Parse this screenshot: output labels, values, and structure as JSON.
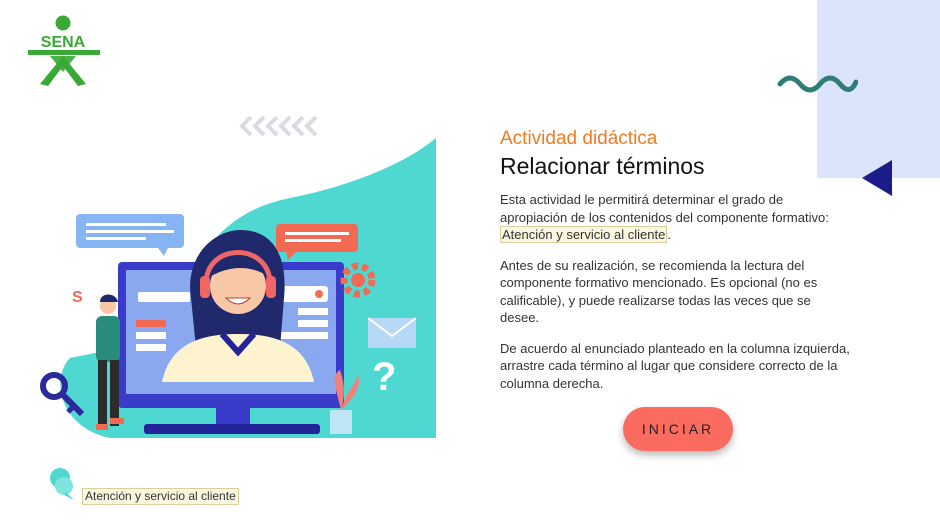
{
  "logo": {
    "text": "SENA",
    "color": "#39a935"
  },
  "decor": {
    "wave_color": "#2e7d76",
    "triangle_color": "#1b1b8a",
    "panel_color": "#dbe4fb",
    "chevron_color": "#d9dbe2"
  },
  "content": {
    "kicker": "Actividad didáctica",
    "title": "Relacionar términos",
    "p1_text": "Esta actividad le permitirá determinar el grado de apropiación de los contenidos del componente formativo: ",
    "p1_link": "Atención y servicio al cliente",
    "p1_end": ".",
    "p2": "Antes de su realización, se recomienda la lectura del componente formativo mencionado. Es opcional (no es calificable), y puede realizarse todas las veces que se desee.",
    "p3": "De acuerdo al enunciado planteado en la columna izquierda, arrastre cada término al lugar que considere correcto de la columna derecha."
  },
  "start_button": {
    "label": "INICIAR",
    "color": "#fb6b5f"
  },
  "footer": {
    "link": "Atención y servicio al cliente",
    "icon": "chat-bubble-icon"
  },
  "illustration": {
    "icon": "customer-service-agent-illustration",
    "accent": "#4fd8d2"
  }
}
